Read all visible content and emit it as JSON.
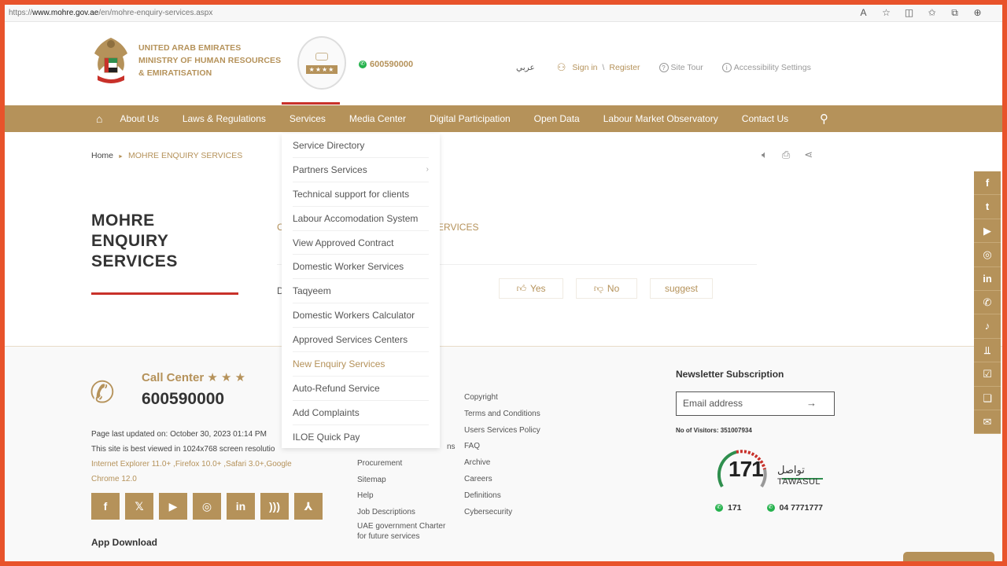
{
  "browser": {
    "url_prefix": "https://",
    "url_host": "www.mohre.gov.ae",
    "url_path": "/en/mohre-enquiry-services.aspx"
  },
  "header": {
    "ministry_line1": "UNITED ARAB EMIRATES",
    "ministry_line2": "MINISTRY OF HUMAN RESOURCES",
    "ministry_line3": "& EMIRATISATION",
    "phone": "600590000",
    "arabic_link": "عربي",
    "sign_in": "Sign in",
    "sep": "\\",
    "register": "Register",
    "site_tour": "Site Tour",
    "accessibility": "Accessibility Settings"
  },
  "nav": {
    "items": [
      "About Us",
      "Laws & Regulations",
      "Services",
      "Media Center",
      "Digital Participation",
      "Open Data",
      "Labour Market Observatory",
      "Contact Us"
    ]
  },
  "dropdown": {
    "items": [
      "Service Directory",
      "Partners Services",
      "Technical support for clients",
      "Labour Accomodation System",
      "View Approved Contract",
      "Domestic Worker Services",
      "Taqyeem",
      "Domestic Workers Calculator",
      "Approved Services Centers",
      "New Enquiry Services",
      "Auto-Refund Service",
      "Add Complaints",
      "ILOE Quick Pay"
    ],
    "highlighted": "New Enquiry Services"
  },
  "breadcrumb": {
    "home": "Home",
    "current": "MOHRE ENQUIRY SERVICES"
  },
  "page": {
    "title_line1": "MOHRE",
    "title_line2": "ENQUIRY",
    "title_line3": "SERVICES",
    "partial_left": "C",
    "partial_right": "ERVICES",
    "partial_feedback": "D",
    "yes": "Yes",
    "no": "No",
    "suggest": "suggest"
  },
  "footer": {
    "call_center_label": "Call Center",
    "call_center_number": "600590000",
    "updated": "Page last updated on: October 30, 2023 01:14 PM",
    "best_viewed": "This site is best viewed in 1024x768 screen resolutio",
    "browsers": "Internet Explorer 11.0+ ,Firefox 10.0+ ,Safari 3.0+,Google Chrome 12.0",
    "app_download": "App Download",
    "col1_partial": "ns",
    "col1": [
      "Procurement",
      "Sitemap",
      "Help",
      "Job Descriptions",
      "UAE government Charter for future services"
    ],
    "col2": [
      "Copyright",
      "Terms and Conditions",
      "Users Services Policy",
      "FAQ",
      "Archive",
      "Careers",
      "Definitions",
      "Cybersecurity"
    ],
    "newsletter_title": "Newsletter Subscription",
    "email_placeholder": "Email address",
    "visitors": "No of Visitors: 351007934",
    "tawasul_num": "171",
    "tawasul_ar": "تواصل",
    "tawasul_en": "TAWASUL",
    "tawasul_phone1": "171",
    "tawasul_phone2": "04 7771777"
  },
  "colors": {
    "accent_gold": "#b5925a",
    "accent_red": "#c8312a",
    "frame": "#e8532b"
  }
}
